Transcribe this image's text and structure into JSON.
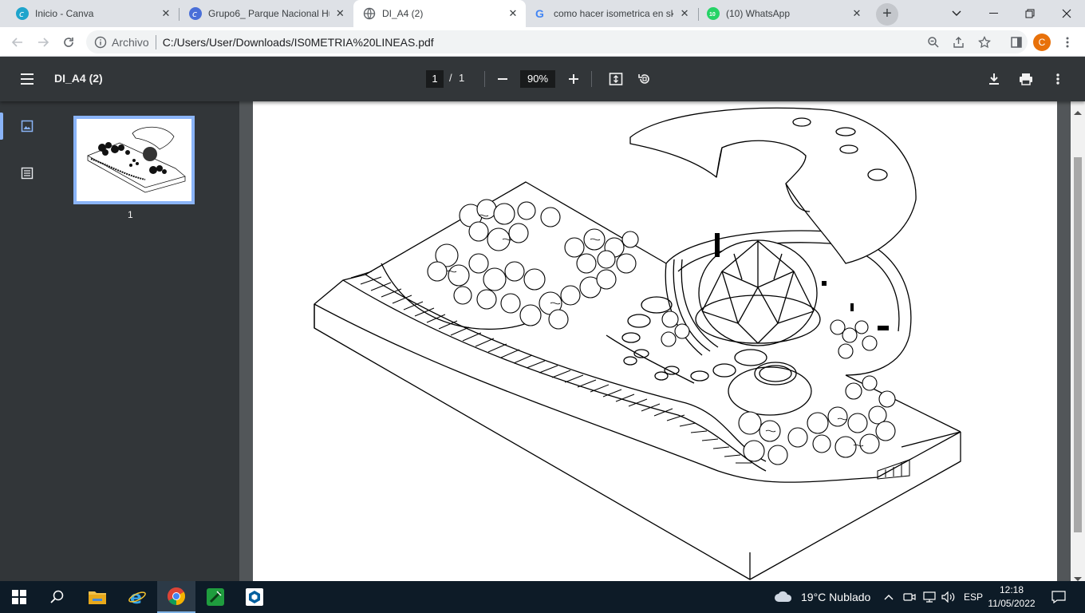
{
  "browser": {
    "tabs": [
      {
        "title": "Inicio - Canva",
        "icon": "canva-icon"
      },
      {
        "title": "Grupo6_ Parque Nacional Hu",
        "icon": "canva-icon"
      },
      {
        "title": "DI_A4 (2)",
        "icon": "globe-icon",
        "active": true
      },
      {
        "title": "como hacer isometrica en sk",
        "icon": "google-icon"
      },
      {
        "title": "(10) WhatsApp",
        "icon": "whatsapp-icon"
      }
    ],
    "new_tab": "+",
    "address": {
      "scheme_label": "Archivo",
      "url": "C:/Users/User/Downloads/IS0METRIA%20LINEAS.pdf"
    },
    "profile_initial": "C"
  },
  "pdf": {
    "title": "DI_A4 (2)",
    "page_current": "1",
    "page_separator": "/",
    "page_total": "1",
    "zoom": "90%",
    "thumbnail_label": "1"
  },
  "taskbar": {
    "weather": "19°C  Nublado",
    "language": "ESP",
    "time": "12:18",
    "date": "11/05/2022"
  },
  "colors": {
    "accent": "#8ab4f8",
    "pdf_toolbar": "#323639",
    "profile": "#e8710a"
  }
}
